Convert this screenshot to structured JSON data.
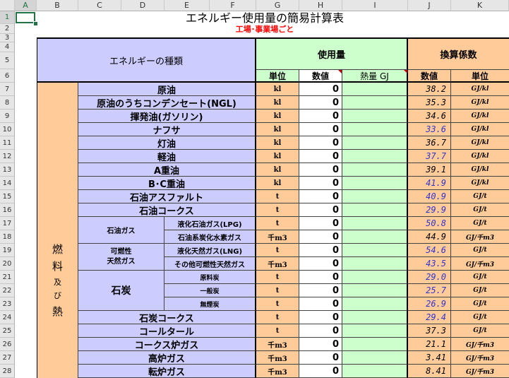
{
  "sheet": {
    "columns": [
      "A",
      "B",
      "C",
      "D",
      "E",
      "F",
      "G",
      "H",
      "I",
      "J",
      "K"
    ],
    "rows": [
      "1",
      "2",
      "3",
      "4",
      "5",
      "6",
      "7",
      "8",
      "9",
      "10",
      "11",
      "12",
      "13",
      "14",
      "15",
      "16",
      "17",
      "18",
      "19",
      "20",
      "21",
      "22",
      "23",
      "24",
      "25",
      "26",
      "27",
      "28"
    ],
    "title": "エネルギー使用量の簡易計算表",
    "subtitle": "工場･事業場ごと"
  },
  "header": {
    "energy_type": "エネルギーの種類",
    "usage": "使用量",
    "conversion": "換算係数",
    "unit": "単位",
    "value": "数値",
    "heat": "熱量 GJ",
    "coef_value": "数値",
    "coef_unit": "単位"
  },
  "category": {
    "c1": "燃",
    "c2": "料",
    "c3": "及",
    "c4": "び",
    "c5": "熱"
  },
  "groups": {
    "oil_gas": "石油ガス",
    "flammable1": "可燃性",
    "flammable2": "天然ガス",
    "coal": "石炭"
  },
  "rows": [
    {
      "name": "原油",
      "unit": "kl",
      "value": "0",
      "coef": "38.2",
      "cunit": "GJ/kl",
      "coef_color": "#000000"
    },
    {
      "name": "原油のうちコンデンセート(NGL)",
      "unit": "kl",
      "value": "0",
      "coef": "35.3",
      "cunit": "GJ/kl",
      "coef_color": "#000000"
    },
    {
      "name": "揮発油(ガソリン)",
      "unit": "kl",
      "value": "0",
      "coef": "34.6",
      "cunit": "GJ/kl",
      "coef_color": "#000000"
    },
    {
      "name": "ナフサ",
      "unit": "kl",
      "value": "0",
      "coef": "33.6",
      "cunit": "GJ/kl",
      "coef_color": "#3333cc"
    },
    {
      "name": "灯油",
      "unit": "kl",
      "value": "0",
      "coef": "36.7",
      "cunit": "GJ/kl",
      "coef_color": "#000000"
    },
    {
      "name": "軽油",
      "unit": "kl",
      "value": "0",
      "coef": "37.7",
      "cunit": "GJ/kl",
      "coef_color": "#3333cc"
    },
    {
      "name": "A重油",
      "unit": "kl",
      "value": "0",
      "coef": "39.1",
      "cunit": "GJ/kl",
      "coef_color": "#000000"
    },
    {
      "name": "B･C重油",
      "unit": "kl",
      "value": "0",
      "coef": "41.9",
      "cunit": "GJ/kl",
      "coef_color": "#3333cc"
    },
    {
      "name": "石油アスファルト",
      "unit": "t",
      "value": "0",
      "coef": "40.9",
      "cunit": "GJ/t",
      "coef_color": "#3333cc"
    },
    {
      "name": "石油コークス",
      "unit": "t",
      "value": "0",
      "coef": "29.9",
      "cunit": "GJ/t",
      "coef_color": "#3333cc"
    },
    {
      "name": "液化石油ガス(LPG)",
      "unit": "t",
      "value": "0",
      "coef": "50.8",
      "cunit": "GJ/t",
      "coef_color": "#3333cc"
    },
    {
      "name": "石油系炭化水素ガス",
      "unit": "千m3",
      "value": "0",
      "coef": "44.9",
      "cunit": "GJ/千m3",
      "coef_color": "#000000"
    },
    {
      "name": "液化天然ガス(LNG)",
      "unit": "t",
      "value": "0",
      "coef": "54.6",
      "cunit": "GJ/t",
      "coef_color": "#3333cc"
    },
    {
      "name": "その他可燃性天然ガス",
      "unit": "千m3",
      "value": "0",
      "coef": "43.5",
      "cunit": "GJ/千m3",
      "coef_color": "#3333cc"
    },
    {
      "name": "原料炭",
      "unit": "t",
      "value": "0",
      "coef": "29.0",
      "cunit": "GJ/t",
      "coef_color": "#3333cc"
    },
    {
      "name": "一般炭",
      "unit": "t",
      "value": "0",
      "coef": "25.7",
      "cunit": "GJ/t",
      "coef_color": "#3333cc"
    },
    {
      "name": "無煙炭",
      "unit": "t",
      "value": "0",
      "coef": "26.9",
      "cunit": "GJ/t",
      "coef_color": "#3333cc"
    },
    {
      "name": "石炭コークス",
      "unit": "t",
      "value": "0",
      "coef": "29.4",
      "cunit": "GJ/t",
      "coef_color": "#3333cc"
    },
    {
      "name": "コールタール",
      "unit": "t",
      "value": "0",
      "coef": "37.3",
      "cunit": "GJ/t",
      "coef_color": "#000000"
    },
    {
      "name": "コークス炉ガス",
      "unit": "千m3",
      "value": "0",
      "coef": "21.1",
      "cunit": "GJ/千m3",
      "coef_color": "#000000"
    },
    {
      "name": "高炉ガス",
      "unit": "千m3",
      "value": "0",
      "coef": "3.41",
      "cunit": "GJ/千m3",
      "coef_color": "#000000"
    },
    {
      "name": "転炉ガス",
      "unit": "千m3",
      "value": "0",
      "coef": "8.41",
      "cunit": "GJ/千m3",
      "coef_color": "#000000"
    }
  ]
}
